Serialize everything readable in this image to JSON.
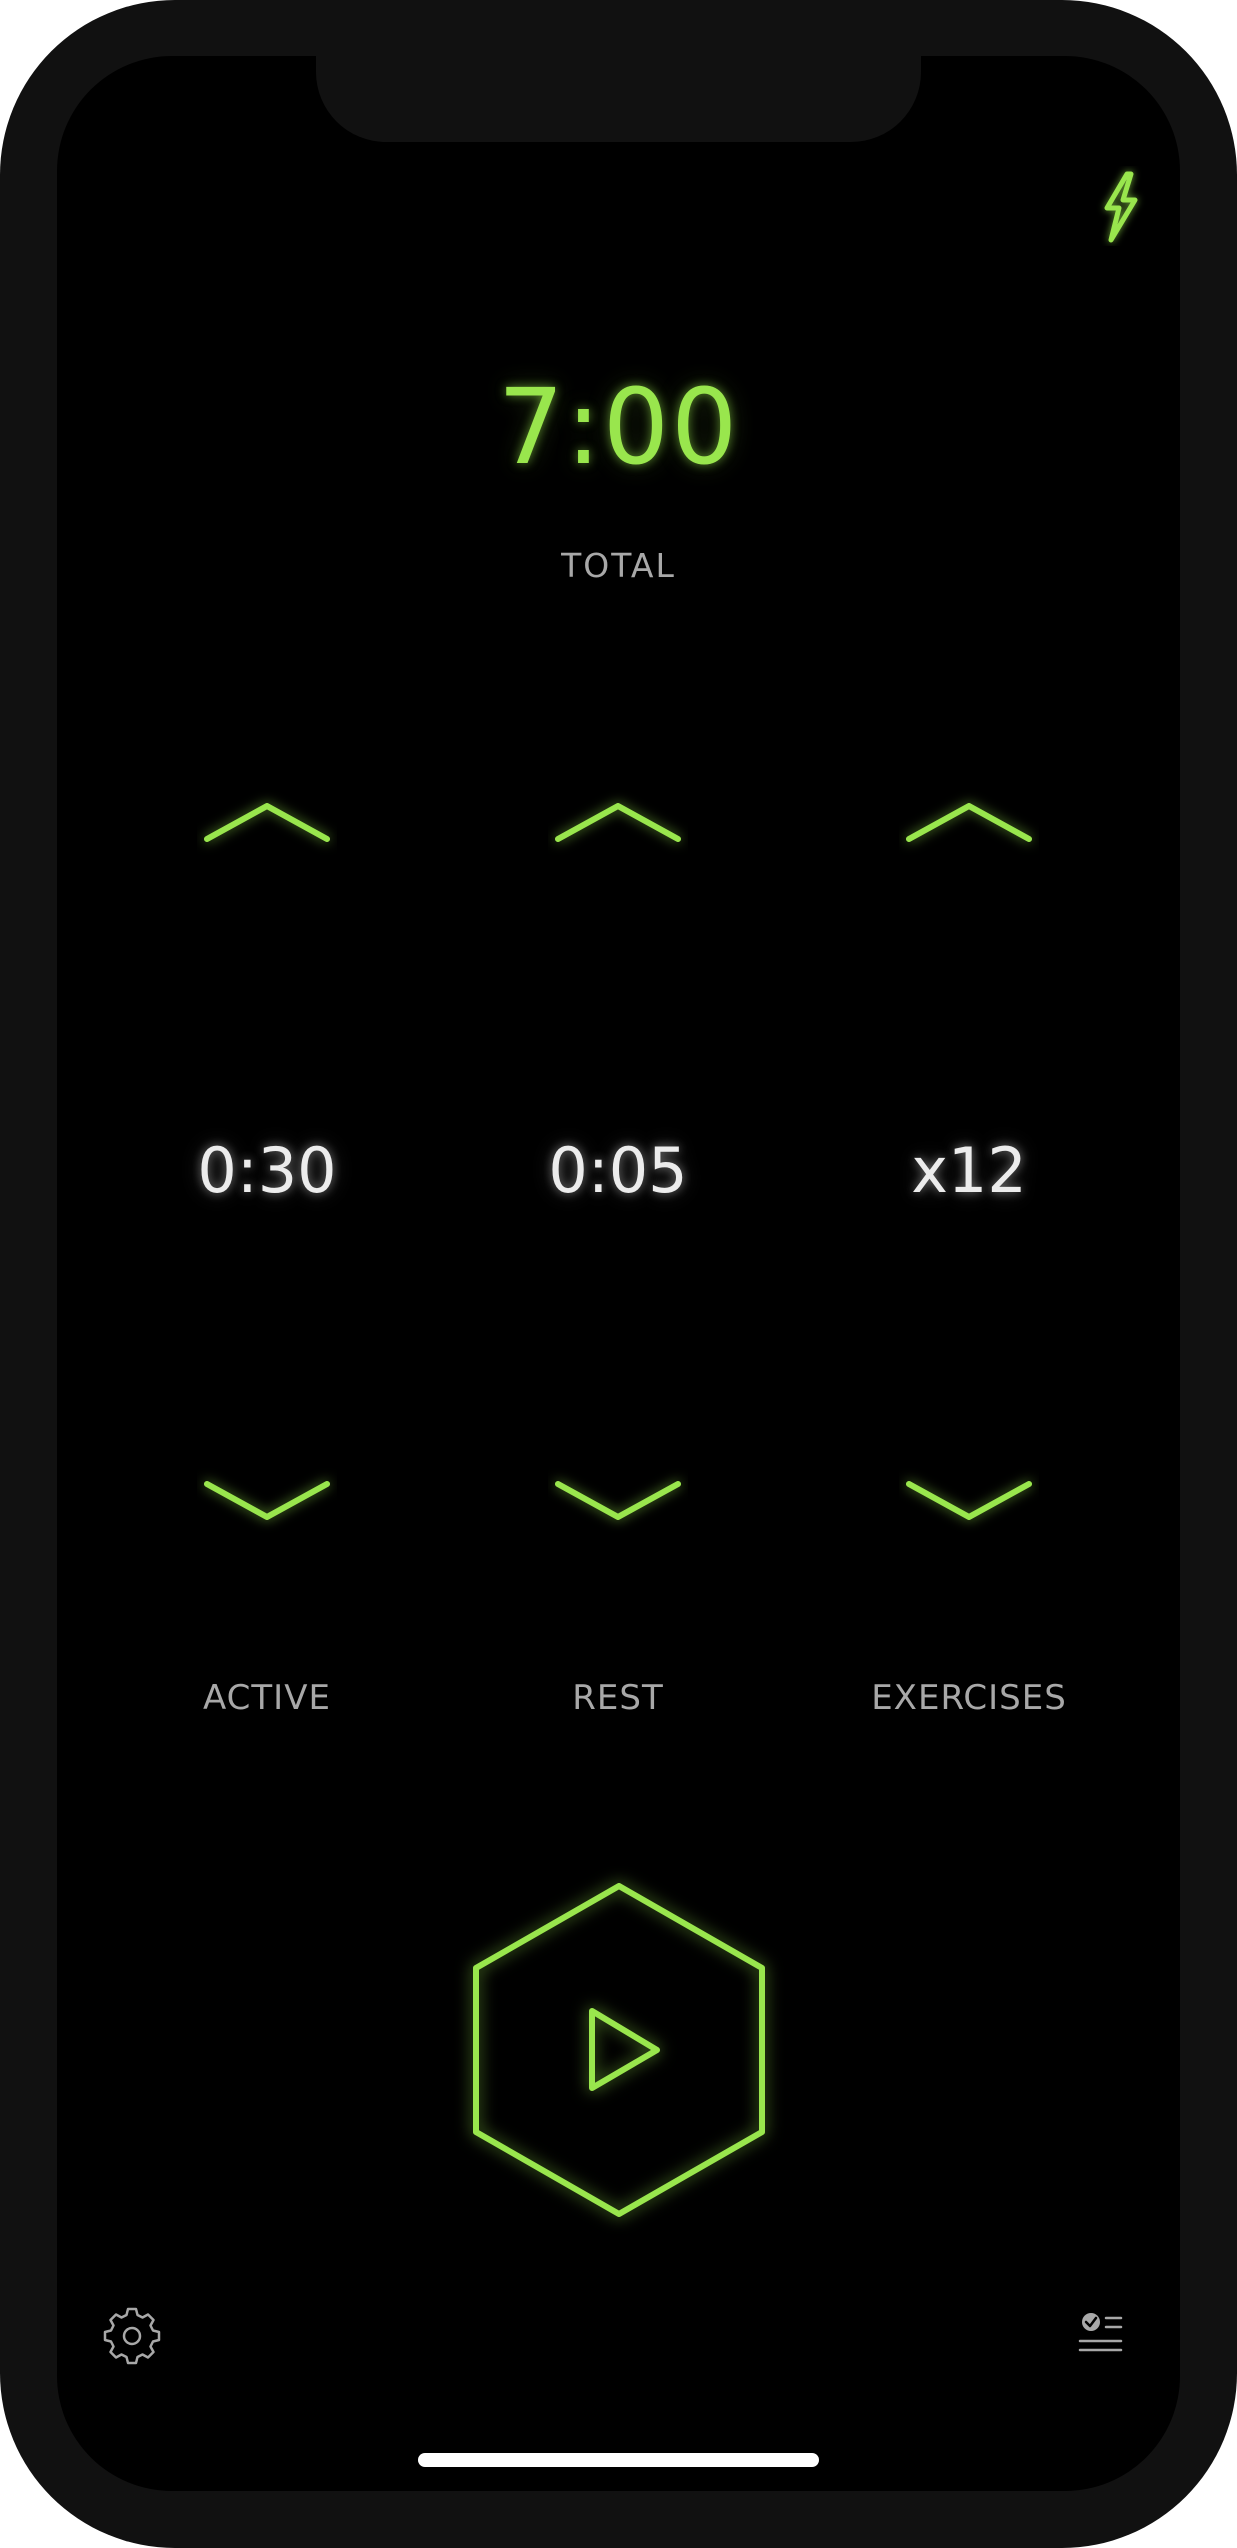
{
  "colors": {
    "accent": "#99e64d",
    "background": "#000000",
    "label": "#a8a8a8",
    "value": "#ececec"
  },
  "header": {
    "action_icon": "lightning-bolt-icon"
  },
  "total": {
    "time": "7:00",
    "label": "TOTAL"
  },
  "controls": [
    {
      "id": "active",
      "value": "0:30",
      "label": "ACTIVE",
      "up_icon": "chevron-up-icon",
      "down_icon": "chevron-down-icon"
    },
    {
      "id": "rest",
      "value": "0:05",
      "label": "REST",
      "up_icon": "chevron-up-icon",
      "down_icon": "chevron-down-icon"
    },
    {
      "id": "exercises",
      "value": "x12",
      "label": "EXERCISES",
      "up_icon": "chevron-up-icon",
      "down_icon": "chevron-down-icon"
    }
  ],
  "start": {
    "icon": "play-hexagon-icon"
  },
  "footer": {
    "left_icon": "gear-icon",
    "right_icon": "checklist-icon"
  }
}
